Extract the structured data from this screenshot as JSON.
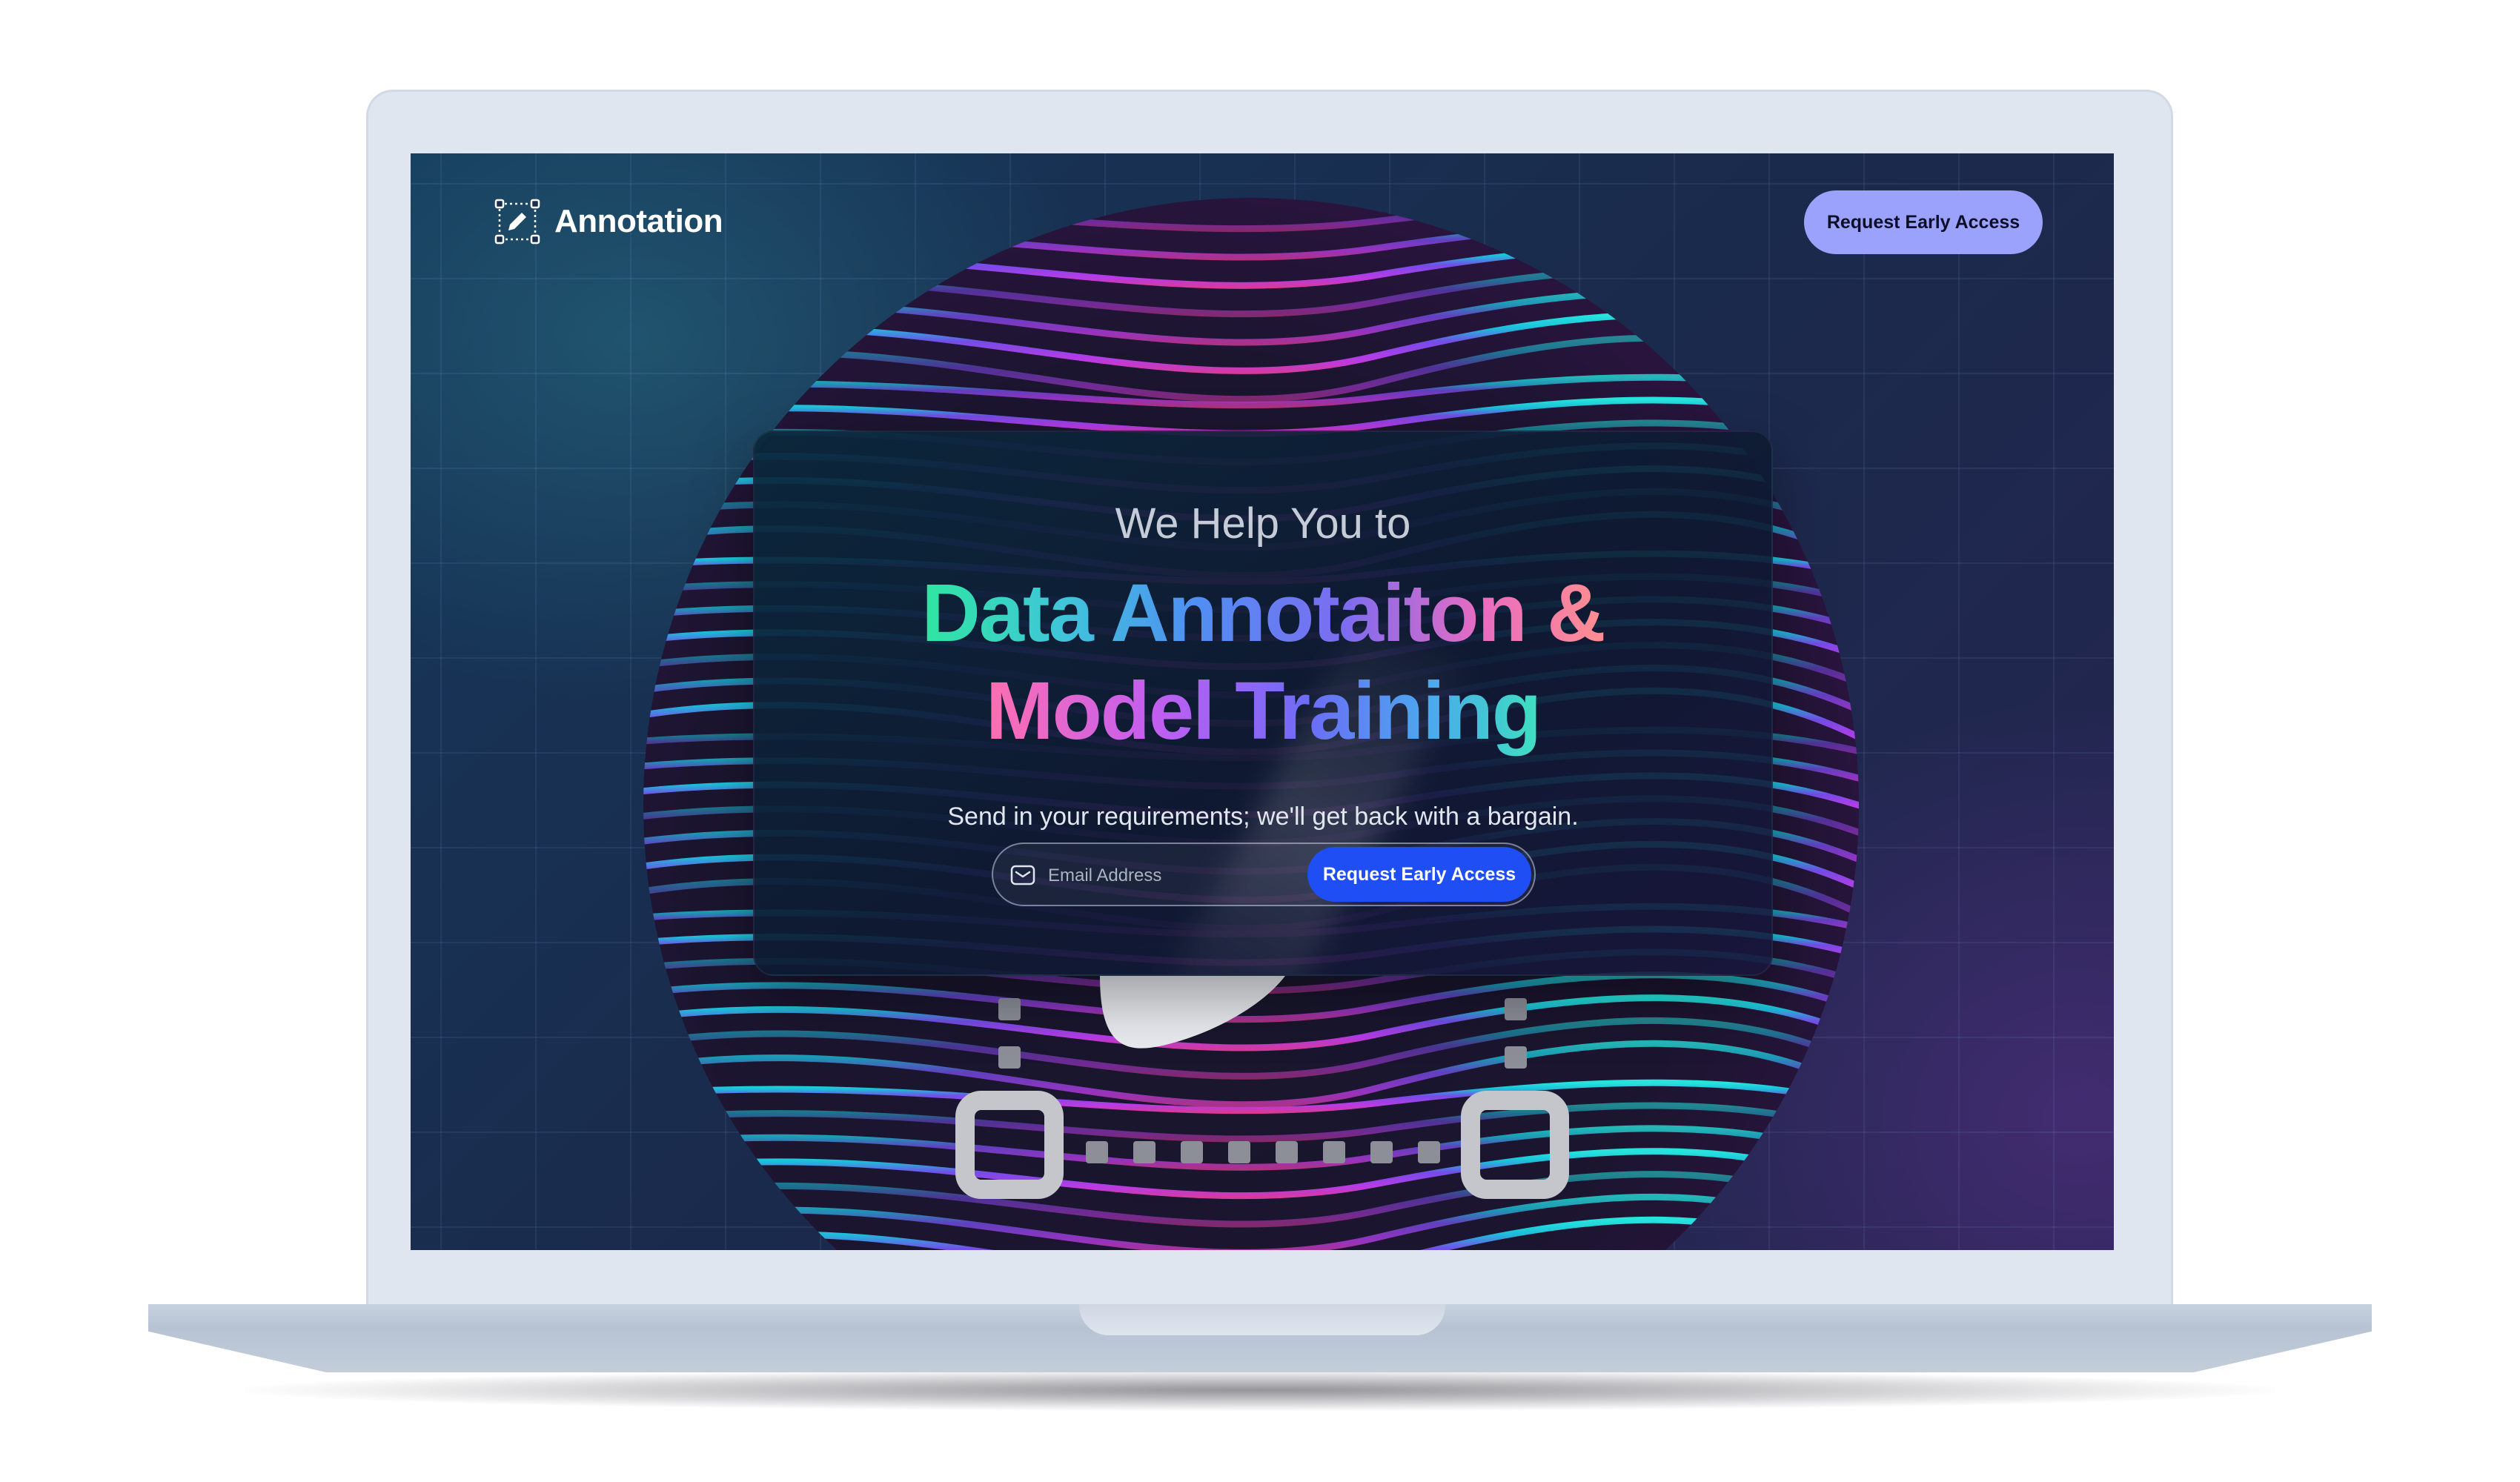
{
  "header": {
    "logo_text": "Annotation",
    "logo_icon": "annotation-pen-icon",
    "cta_label": "Request Early Access"
  },
  "hero": {
    "eyebrow": "We Help You to",
    "headline_line1": "Data Annotaiton &",
    "headline_line2": "Model Training",
    "subtext": "Send in your requirements; we'll get back with a bargain.",
    "email_placeholder": "Email Address",
    "email_value": "",
    "email_icon": "mail-icon",
    "submit_label": "Request Early Access"
  },
  "colors": {
    "header_cta_bg": "#9aa2fb",
    "submit_bg": "#1f4ef5",
    "screen_bg": "#1a2a4c",
    "gradient_green": "#2ee6a0",
    "gradient_blue": "#4f8ff3",
    "gradient_pink": "#ff6fb0"
  }
}
